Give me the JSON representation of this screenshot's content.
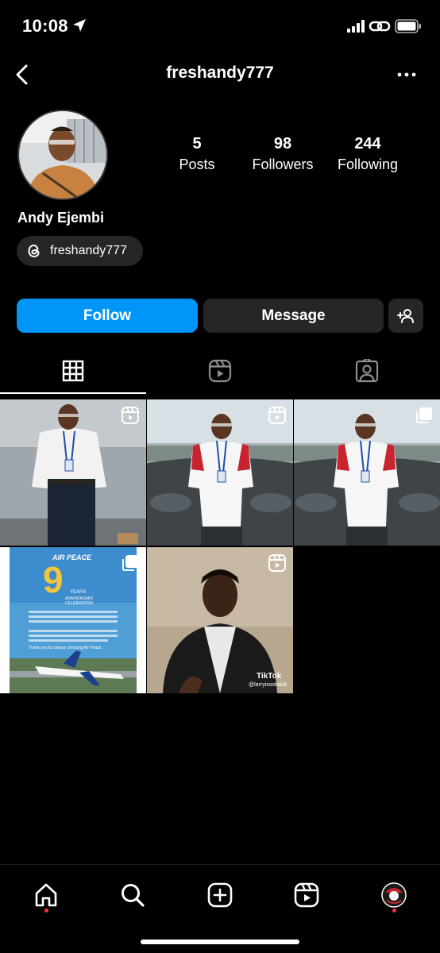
{
  "status_bar": {
    "time": "10:08"
  },
  "header": {
    "username": "freshandy777",
    "back_icon": "chevron-left-icon",
    "more_icon": "more-horizontal-icon"
  },
  "profile": {
    "display_name": "Andy Ejembi",
    "threads_handle": "freshandy777",
    "stats": [
      {
        "value": "5",
        "label": "Posts"
      },
      {
        "value": "98",
        "label": "Followers"
      },
      {
        "value": "244",
        "label": "Following"
      }
    ]
  },
  "actions": {
    "follow_label": "Follow",
    "message_label": "Message"
  },
  "tabs": [
    {
      "icon": "grid-icon",
      "active": true
    },
    {
      "icon": "reels-icon",
      "active": false
    },
    {
      "icon": "tagged-icon",
      "active": false
    }
  ],
  "posts": [
    {
      "type": "reel"
    },
    {
      "type": "reel"
    },
    {
      "type": "carousel"
    },
    {
      "type": "carousel",
      "overlay_text": {
        "brand": "AIR PEACE",
        "number": "9",
        "years": "YEARS",
        "anniv": "ANNIVERSARY CELEBRATION",
        "thanks": "Thank you for always choosing Air Peace."
      }
    },
    {
      "type": "reel",
      "overlay_text": {
        "tiktok": "TikTok",
        "handle": "@larryissotakid"
      }
    }
  ],
  "bottom_nav": [
    {
      "icon": "home-icon",
      "active": true
    },
    {
      "icon": "search-icon",
      "active": false
    },
    {
      "icon": "create-icon",
      "active": false
    },
    {
      "icon": "reels-icon",
      "active": false
    },
    {
      "icon": "profile-avatar-icon",
      "active": false
    }
  ],
  "colors": {
    "background": "#000000",
    "accent_blue": "#0095f6",
    "secondary_button": "#262626",
    "notification_red": "#ff3040"
  }
}
